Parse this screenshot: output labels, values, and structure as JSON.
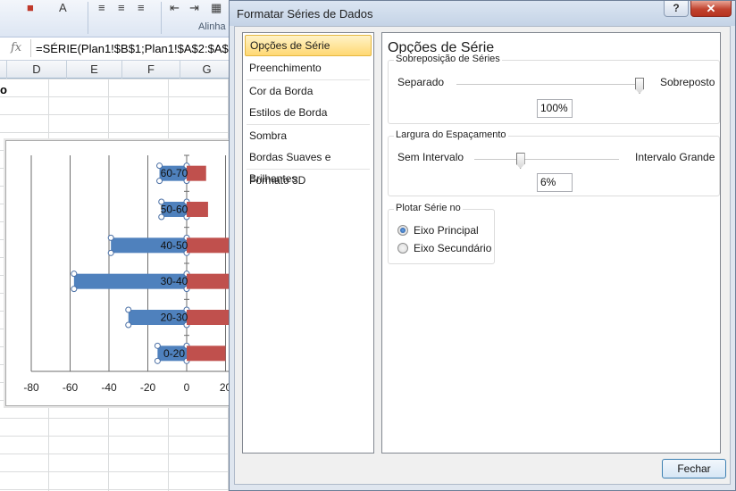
{
  "excel": {
    "ribbon": {
      "group_label": "Alinha"
    },
    "formula_bar": {
      "fx_label": "fx",
      "formula": "=SÉRIE(Plan1!$B$1;Plan1!$A$2:$A$"
    },
    "columns": [
      "D",
      "E",
      "F",
      "G"
    ],
    "cell_text": "o",
    "chart": {
      "x_ticks": [
        "-80",
        "-60",
        "-40",
        "-20",
        "0",
        "20"
      ]
    }
  },
  "chart_data": {
    "type": "bar",
    "orientation": "horizontal",
    "categories": [
      "0-20",
      "20-30",
      "30-40",
      "40-50",
      "50-60",
      "60-70"
    ],
    "series": [
      {
        "values": [
          -15,
          -30,
          -58,
          -39,
          -13,
          -14
        ],
        "color": "#4f81bd",
        "selected": true
      },
      {
        "values": [
          20,
          25,
          25,
          25,
          11,
          10
        ],
        "color": "#c0504d"
      }
    ],
    "x_ticks": [
      -80,
      -60,
      -40,
      -20,
      0,
      20
    ],
    "xlim": [
      -80,
      20
    ],
    "grid": "vertical"
  },
  "dialog": {
    "title": "Formatar Séries de Dados",
    "help_label": "?",
    "close_label": "✕",
    "nav": [
      "Opções de Série",
      "Preenchimento",
      "Cor da Borda",
      "Estilos de Borda",
      "Sombra",
      "Bordas Suaves e Brilhantes",
      "Formato 3D"
    ],
    "panel_title": "Opções de Série",
    "overlap": {
      "label": "Sobreposição de Séries",
      "left": "Separado",
      "right": "Sobreposto",
      "value": "100%",
      "slider_fraction": 1.0
    },
    "gap": {
      "label": "Largura do Espaçamento",
      "left": "Sem Intervalo",
      "right": "Intervalo Grande",
      "value": "6%",
      "slider_fraction": 0.03
    },
    "plot_on": {
      "label": "Plotar Série no",
      "primary": "Eixo Principal",
      "secondary": "Eixo Secundário",
      "selected": "primary"
    },
    "close_button": "Fechar",
    "colors": {
      "selected_nav": "#ffd873",
      "accent": "#3c7fb1"
    }
  }
}
